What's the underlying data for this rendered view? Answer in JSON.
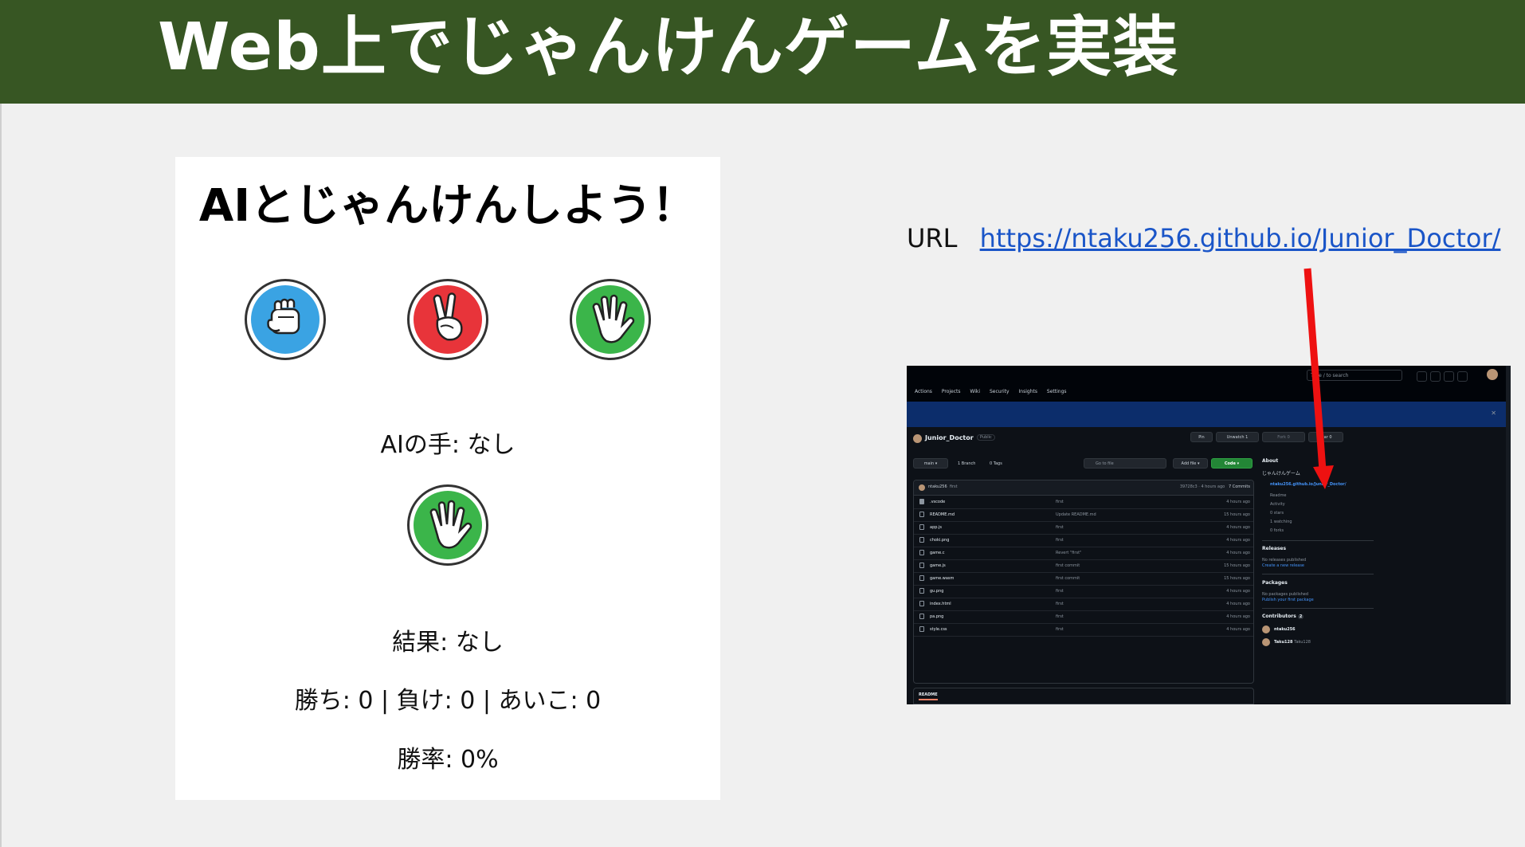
{
  "slide": {
    "title": "Web上でじゃんけんゲームを実装",
    "colors": {
      "header_bg": "#375623",
      "background": "#f0f0f0",
      "arrow": "#ee1111"
    }
  },
  "app": {
    "title": "AIとじゃんけんしよう！",
    "hands": [
      {
        "name": "rock",
        "icon": "fist-icon",
        "color": "#3aa3e3"
      },
      {
        "name": "scissors",
        "icon": "peace-sign-icon",
        "color": "#e8343a"
      },
      {
        "name": "paper",
        "icon": "open-hand-icon",
        "color": "#3bb54a"
      }
    ],
    "ai_hand_label": "AIの手: なし",
    "ai_hand_icon": "open-hand-icon",
    "result_label": "結果: なし",
    "score_label": "勝ち: 0 | 負け: 0 | あいこ: 0",
    "win_rate_label": "勝率: 0%"
  },
  "url": {
    "label": "URL",
    "link": "https://ntaku256.github.io/Junior_Doctor/"
  },
  "github": {
    "search_placeholder": "Type / to search",
    "nav": [
      "Actions",
      "Projects",
      "Wiki",
      "Security",
      "Insights",
      "Settings"
    ],
    "repo_name": "Junior_Doctor",
    "visibility": "Public",
    "pin": "Pin",
    "unwatch": "Unwatch",
    "watch_count": "1",
    "fork": "Fork",
    "fork_count": "0",
    "star": "Star",
    "star_count": "0",
    "branch_button": "main",
    "branches": "1 Branch",
    "tags": "0 Tags",
    "goto_file": "Go to file",
    "goto_key": "t",
    "add_file": "Add file",
    "code": "Code",
    "last_commit_user": "ntaku256",
    "last_commit_msg": "first",
    "last_commit_info": "39728c3 · 4 hours ago",
    "commits": "7 Commits",
    "files": [
      {
        "name": ".vscode",
        "msg": "first",
        "time": "4 hours ago",
        "folder": true
      },
      {
        "name": "README.md",
        "msg": "Update README.md",
        "time": "15 hours ago",
        "folder": false
      },
      {
        "name": "app.js",
        "msg": "first",
        "time": "4 hours ago",
        "folder": false
      },
      {
        "name": "choki.png",
        "msg": "first",
        "time": "4 hours ago",
        "folder": false
      },
      {
        "name": "game.c",
        "msg": "Revert \"first\"",
        "time": "4 hours ago",
        "folder": false
      },
      {
        "name": "game.js",
        "msg": "first commit",
        "time": "15 hours ago",
        "folder": false
      },
      {
        "name": "game.wasm",
        "msg": "first commit",
        "time": "15 hours ago",
        "folder": false
      },
      {
        "name": "gu.png",
        "msg": "first",
        "time": "4 hours ago",
        "folder": false
      },
      {
        "name": "index.html",
        "msg": "first",
        "time": "4 hours ago",
        "folder": false
      },
      {
        "name": "pa.png",
        "msg": "first",
        "time": "4 hours ago",
        "folder": false
      },
      {
        "name": "style.css",
        "msg": "first",
        "time": "4 hours ago",
        "folder": false
      }
    ],
    "readme_tab": "README",
    "about": {
      "heading": "About",
      "description": "じゃんけんゲーム",
      "link": "ntaku256.github.io/Junior_Doctor/",
      "items": [
        "Readme",
        "Activity",
        "0 stars",
        "1 watching",
        "0 forks"
      ]
    },
    "releases": {
      "heading": "Releases",
      "text": "No releases published",
      "link": "Create a new release"
    },
    "packages": {
      "heading": "Packages",
      "text": "No packages published",
      "link": "Publish your first package"
    },
    "contributors": {
      "heading": "Contributors",
      "count": "2",
      "people": [
        {
          "name": "ntaku256",
          "extra": ""
        },
        {
          "name": "Taku128",
          "extra": "Taku128"
        }
      ]
    }
  }
}
